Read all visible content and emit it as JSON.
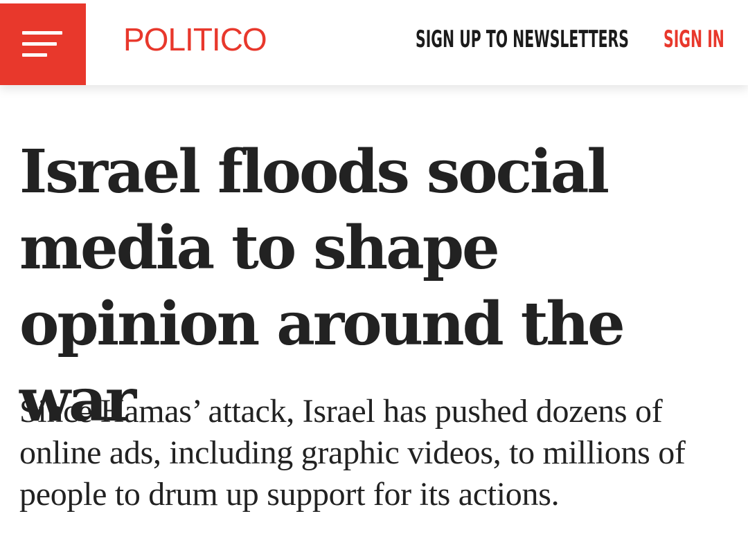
{
  "header": {
    "menu_icon": "hamburger-menu-icon",
    "logo_text": "POLITICO",
    "newsletters_label": "SIGN UP TO NEWSLETTERS",
    "signin_label": "SIGN IN",
    "brand_color": "#e8382c"
  },
  "article": {
    "headline": "Israel floods social media to shape opinion around the war",
    "dek": "Since Hamas’ attack, Israel has pushed dozens of online ads, including graphic videos, to millions of people to drum up support for its actions."
  }
}
